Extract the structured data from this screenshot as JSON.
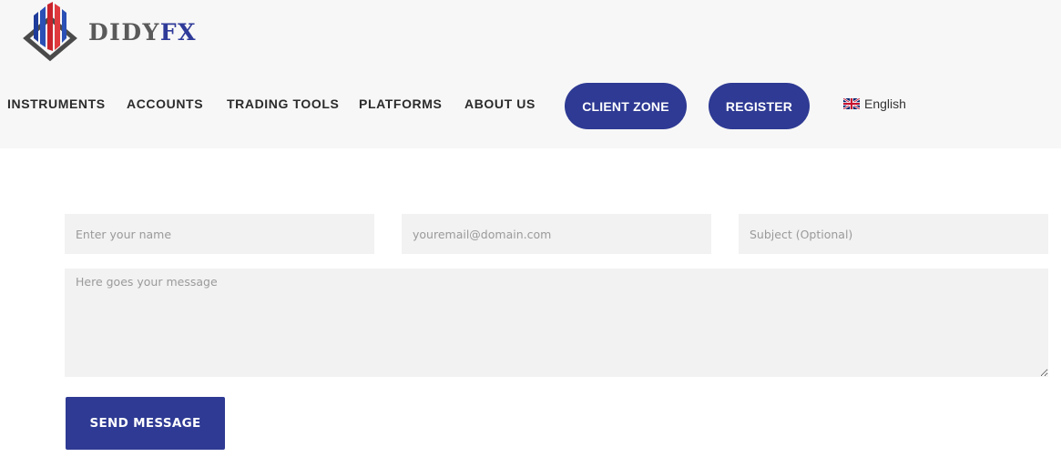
{
  "brand": {
    "name_part1": "DIDY",
    "name_part2": "FX"
  },
  "nav": {
    "items": [
      {
        "label": "INSTRUMENTS"
      },
      {
        "label": "ACCOUNTS"
      },
      {
        "label": "TRADING TOOLS"
      },
      {
        "label": "PLATFORMS"
      },
      {
        "label": "ABOUT US"
      }
    ],
    "client_zone": "CLIENT ZONE",
    "register": "REGISTER",
    "language": "English"
  },
  "form": {
    "name_placeholder": "Enter your name",
    "email_placeholder": "youremail@domain.com",
    "subject_placeholder": "Subject (Optional)",
    "message_placeholder": "Here goes your message",
    "send_label": "SEND MESSAGE"
  },
  "colors": {
    "accent": "#2e3a93",
    "header_bg": "#f7f7f7",
    "field_bg": "#f2f2f2"
  },
  "icons": {
    "logo": "didyfx-logo-icon",
    "flag": "uk-flag-icon"
  }
}
